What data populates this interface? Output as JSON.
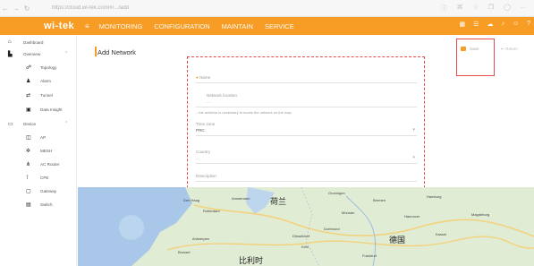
{
  "browser": {
    "url": "https://cloud.wi-tek.com/#/.../add",
    "icons": [
      "back-icon",
      "forward-icon",
      "reload-icon",
      "info-icon",
      "extensions-icon",
      "favorite-icon",
      "collections-icon",
      "profile-icon",
      "more-icon"
    ]
  },
  "header": {
    "logo": "wi-tek",
    "nav": [
      "MONITORING",
      "CONFIGURATION",
      "MAINTAIN",
      "SERVICE"
    ],
    "icons": [
      "grid-icon",
      "list-icon",
      "cloud-icon",
      "bell-icon",
      "user-icon",
      "help-icon"
    ],
    "accent": "#f79d25"
  },
  "sidebar": {
    "items": [
      {
        "label": "Dashboard",
        "icon": "home-icon"
      },
      {
        "label": "Overview",
        "icon": "building-icon"
      },
      {
        "label": "Topology",
        "icon": "topology-icon"
      },
      {
        "label": "Alarm",
        "icon": "alarm-icon"
      },
      {
        "label": "Tunnel",
        "icon": "tunnel-icon"
      },
      {
        "label": "Data Insight",
        "icon": "insight-icon"
      },
      {
        "label": "Device",
        "icon": "monitor-icon"
      },
      {
        "label": "AP",
        "icon": "ap-icon"
      },
      {
        "label": "MESH",
        "icon": "mesh-icon"
      },
      {
        "label": "AC Router",
        "icon": "router-icon"
      },
      {
        "label": "CPE",
        "icon": "cpe-icon"
      },
      {
        "label": "Gateway",
        "icon": "gateway-icon"
      },
      {
        "label": "Switch",
        "icon": "switch-icon"
      }
    ]
  },
  "main": {
    "title": "Add Network",
    "save": "Save",
    "return": "Return",
    "form": {
      "name_placeholder": "Name",
      "address_label": "Network location",
      "address_value": "...",
      "hint": "...the address is necessary to locate the network on the map",
      "timezone_label": "Time zone",
      "timezone_value": "PRC",
      "country_label": "Country",
      "country_value": "...",
      "remark_placeholder": "Description"
    }
  },
  "map": {
    "country_labels": [
      "荷兰",
      "德国",
      "比利时"
    ],
    "city_labels": [
      "Groningen",
      "Den Haag",
      "Rotterdam",
      "Amsterdam",
      "Bremen",
      "Hamburg",
      "Hannover",
      "Düsseldorf",
      "Dortmund",
      "Köln",
      "Frankfurt",
      "Brussel",
      "Antwerpen",
      "Magdeburg",
      "Kassel",
      "Münster"
    ]
  }
}
